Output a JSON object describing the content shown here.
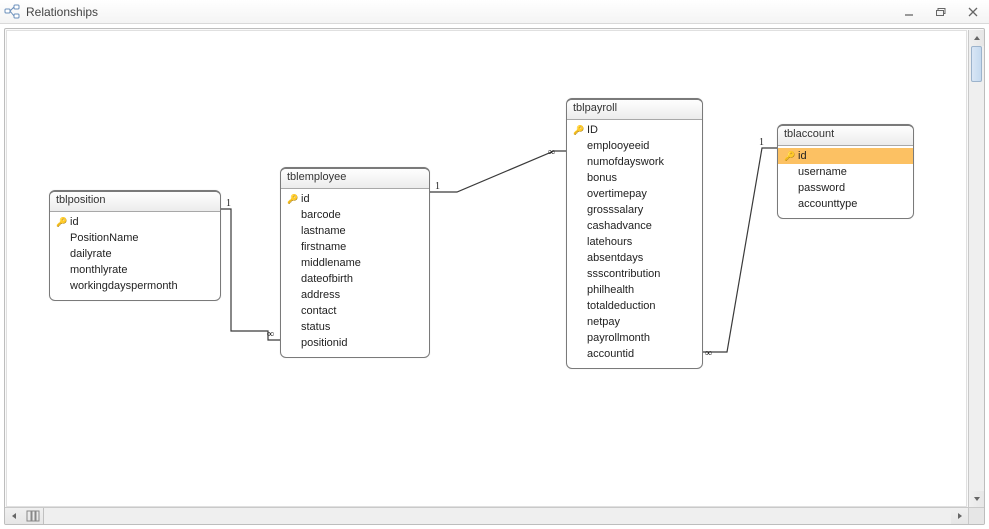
{
  "window": {
    "title": "Relationships"
  },
  "tables": {
    "tblposition": {
      "name": "tblposition",
      "fields": [
        "id",
        "PositionName",
        "dailyrate",
        "monthlyrate",
        "workingdayspermonth"
      ],
      "pk_index": 0
    },
    "tblemployee": {
      "name": "tblemployee",
      "fields": [
        "id",
        "barcode",
        "lastname",
        "firstname",
        "middlename",
        "dateofbirth",
        "address",
        "contact",
        "status",
        "positionid"
      ],
      "pk_index": 0
    },
    "tblpayroll": {
      "name": "tblpayroll",
      "fields": [
        "ID",
        "emplooyeeid",
        "numofdayswork",
        "bonus",
        "overtimepay",
        "grosssalary",
        "cashadvance",
        "latehours",
        "absentdays",
        "ssscontribution",
        "philhealth",
        "totaldeduction",
        "netpay",
        "payrollmonth",
        "accountid"
      ],
      "pk_index": 0
    },
    "tblaccount": {
      "name": "tblaccount",
      "fields": [
        "id",
        "username",
        "password",
        "accounttype"
      ],
      "pk_index": 0,
      "selected_index": 0
    }
  },
  "relationships": [
    {
      "from": "tblposition",
      "to": "tblemployee",
      "from_card": "1",
      "to_card": "∞"
    },
    {
      "from": "tblemployee",
      "to": "tblpayroll",
      "from_card": "1",
      "to_card": "∞"
    },
    {
      "from": "tblaccount",
      "to": "tblpayroll",
      "from_card": "1",
      "to_card": "∞"
    }
  ]
}
